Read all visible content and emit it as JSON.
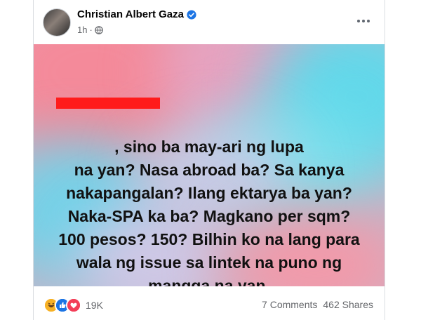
{
  "post": {
    "author": "Christian Albert Gaza",
    "time": "1h",
    "separator": "·",
    "audience_icon": "globe-icon",
    "verified_icon": "verified-badge-icon",
    "more_icon": "more-horizontal-icon",
    "text": ", sino ba may-ari ng lupa\nna yan? Nasa abroad ba? Sa kanya\nnakapangalan? Ilang ektarya ba yan?\nNaka-SPA ka ba? Magkano per sqm?\n100 pesos? 150? Bilhin ko na lang para\nwala ng issue sa lintek na puno ng\nmangga na yan.",
    "background_colors": [
      "#f48a9a",
      "#e8a2c0",
      "#62d8ea",
      "#76e2ee",
      "#c9cbe6"
    ]
  },
  "footer": {
    "reaction_icons": [
      "haha-icon",
      "like-icon",
      "love-icon"
    ],
    "reaction_count": "19K",
    "comments": "7 Comments",
    "shares": "462 Shares"
  },
  "colors": {
    "accent": "#1b74e4",
    "redaction": "#ff1b1b",
    "meta_text": "#65676b"
  }
}
